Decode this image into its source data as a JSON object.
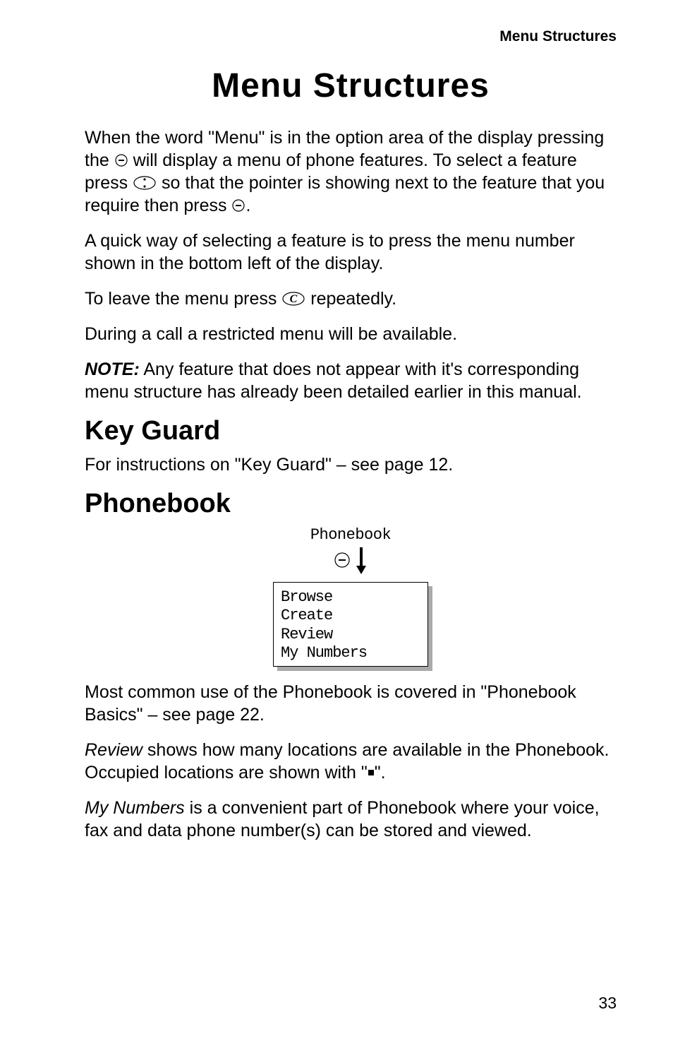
{
  "header_right": "Menu Structures",
  "page_title": "Menu Structures",
  "para1_a": "When the word \"Menu\" is in the option area of the display pressing the ",
  "para1_b": " will display a menu of phone features. To select a feature press ",
  "para1_c": " so that the pointer is showing next to the feature that you require then press ",
  "para1_d": ".",
  "para2": "A quick way of selecting a feature is to press the menu number shown in the bottom left of the display.",
  "para3_a": "To leave the menu press ",
  "para3_b": " repeatedly.",
  "para4": "During a call a restricted menu will be available.",
  "note_label": "NOTE:",
  "note_text": " Any feature that does not appear with it's corresponding menu structure has already been detailed earlier in this manual.",
  "keyguard_heading": "Key Guard",
  "keyguard_text": "For instructions on \"Key Guard\" – see page 12.",
  "phonebook_heading": "Phonebook",
  "phonebook_label": "Phonebook",
  "screen_items": {
    "l1": "Browse",
    "l2": "Create",
    "l3": "Review",
    "l4": "My Numbers"
  },
  "para5": "Most common use of the Phonebook is covered in \"Phonebook Basics\" – see page 22.",
  "para6_a": "Review",
  "para6_b": " shows how many locations are available in the Phonebook. Occupied locations are shown with \"",
  "para6_c": "\".",
  "para7_a": "My Numbers",
  "para7_b": " is a convenient part of Phonebook where your voice, fax and data phone number(s) can be stored and viewed.",
  "page_num": "33"
}
